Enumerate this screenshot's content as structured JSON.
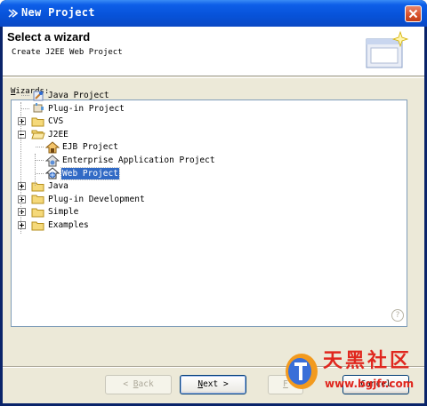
{
  "window": {
    "title": "New Project",
    "accent": "#0a48c4"
  },
  "banner": {
    "title": "Select a wizard",
    "description": "Create J2EE Web Project"
  },
  "wizards_label_prefix": "W",
  "wizards_label_rest": "izards:",
  "tree": [
    {
      "label": "Java Project",
      "icon": "java-project-icon",
      "depth": 0,
      "expander": "none"
    },
    {
      "label": "Plug-in Project",
      "icon": "plugin-project-icon",
      "depth": 0,
      "expander": "none"
    },
    {
      "label": "CVS",
      "icon": "folder-icon",
      "depth": 0,
      "expander": "plus"
    },
    {
      "label": "J2EE",
      "icon": "folder-open-icon",
      "depth": 0,
      "expander": "minus"
    },
    {
      "label": "EJB Project",
      "icon": "ejb-project-icon",
      "depth": 1,
      "expander": "none"
    },
    {
      "label": "Enterprise Application Project",
      "icon": "enterprise-project-icon",
      "depth": 1,
      "expander": "none"
    },
    {
      "label": "Web Project",
      "icon": "web-project-icon",
      "depth": 1,
      "expander": "none",
      "selected": true
    },
    {
      "label": "Java",
      "icon": "folder-icon",
      "depth": 0,
      "expander": "plus"
    },
    {
      "label": "Plug-in Development",
      "icon": "folder-icon",
      "depth": 0,
      "expander": "plus"
    },
    {
      "label": "Simple",
      "icon": "folder-icon",
      "depth": 0,
      "expander": "plus"
    },
    {
      "label": "Examples",
      "icon": "folder-icon",
      "depth": 0,
      "expander": "plus"
    }
  ],
  "buttons": {
    "back_prefix": "< ",
    "back_mnemonic": "B",
    "back_rest": "ack",
    "next_mnemonic": "N",
    "next_rest": "ext >",
    "finish_mnemonic": "F",
    "cancel": "Cancel"
  },
  "help": "?",
  "watermark": {
    "text": "天黑社区",
    "url": "www.bgjfr.com"
  }
}
